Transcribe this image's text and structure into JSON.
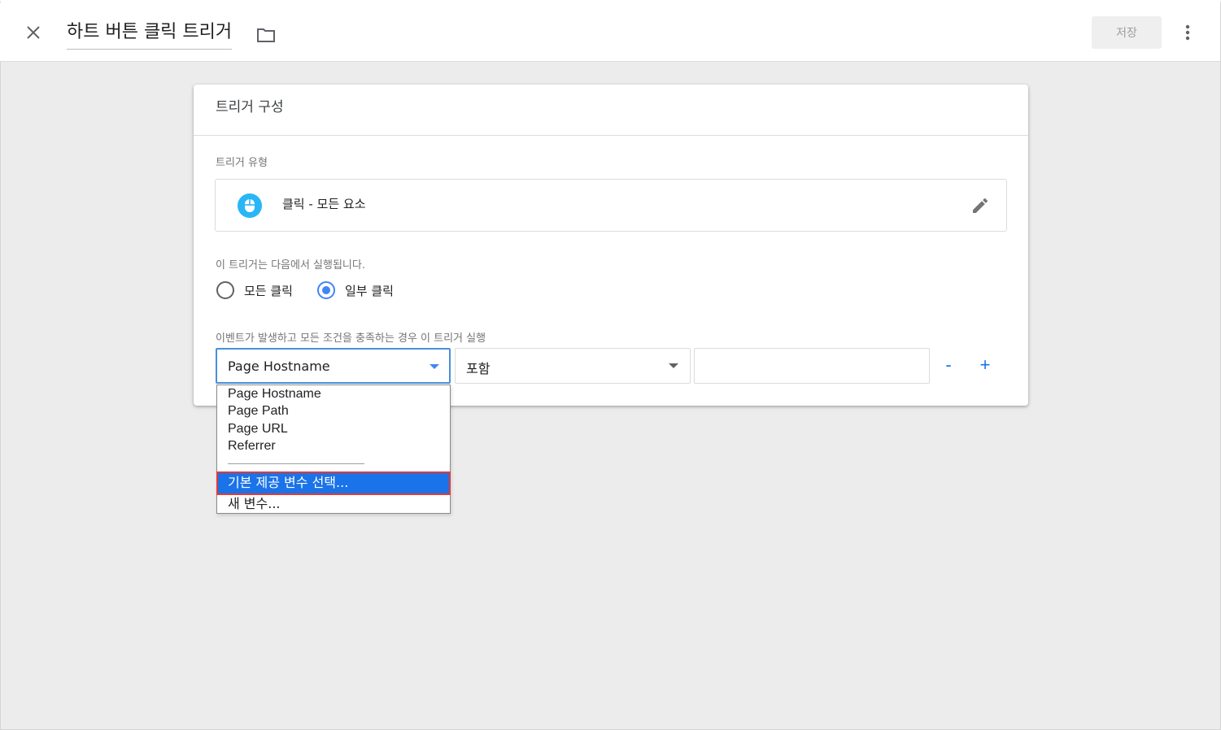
{
  "header": {
    "title": "하트 버튼 클릭 트리거",
    "save_label": "저장",
    "close_icon": "close-icon",
    "folder_icon": "folder-icon",
    "more_icon": "more-vert-icon"
  },
  "card": {
    "heading": "트리거 구성",
    "trigger_type_label": "트리거 유형",
    "trigger_type_value": "클릭 - 모든 요소",
    "trigger_type_icon": "mouse-icon",
    "fires_on_label": "이 트리거는 다음에서 실행됩니다.",
    "radio_options": [
      {
        "label": "모든 클릭",
        "selected": false
      },
      {
        "label": "일부 클릭",
        "selected": true
      }
    ],
    "condition_label": "이벤트가 발생하고 모든 조건을 충족하는 경우 이 트리거 실행",
    "variable_select": "Page Hostname",
    "operator_select": "포함",
    "value_input": "",
    "minus_label": "-",
    "plus_label": "+"
  },
  "dropdown": {
    "items": [
      "Page Hostname",
      "Page Path",
      "Page URL",
      "Referrer"
    ],
    "builtin_label": "기본 제공 변수 선택...",
    "new_var_label": "새 변수..."
  },
  "colors": {
    "accent": "#1a73e8",
    "radio_on": "#4285f4",
    "icon_bg": "#29b6f6",
    "highlight_border": "#e53935"
  }
}
